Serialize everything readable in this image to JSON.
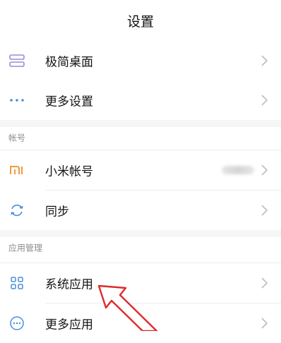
{
  "header": {
    "title": "设置"
  },
  "rows": {
    "minimal_desktop": {
      "label": "极简桌面",
      "icon": "layers-icon"
    },
    "more_settings": {
      "label": "更多设置",
      "icon": "ellipsis-icon"
    },
    "mi_account": {
      "label": "小米帐号",
      "icon": "mi-logo-icon"
    },
    "sync": {
      "label": "同步",
      "icon": "sync-icon"
    },
    "system_apps": {
      "label": "系统应用",
      "icon": "grid-icon"
    },
    "more_apps": {
      "label": "更多应用",
      "icon": "more-circle-icon"
    }
  },
  "sections": {
    "account": "帐号",
    "app_management": "应用管理"
  },
  "colors": {
    "accent_blue": "#4a8de0",
    "mi_orange": "#f39a3c",
    "purple": "#9b8ad6",
    "arrow_red": "#e02a2a"
  }
}
